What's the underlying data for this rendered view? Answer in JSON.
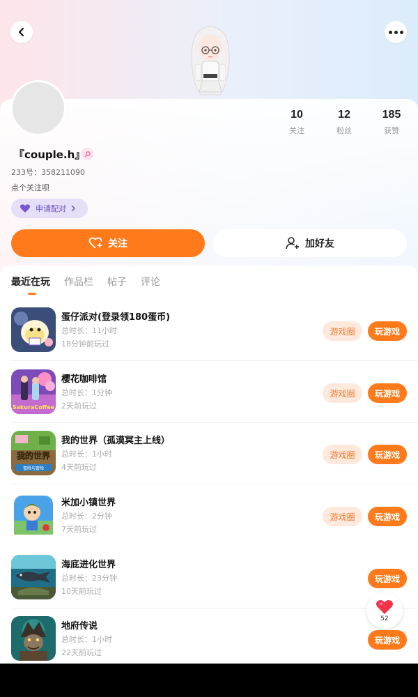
{
  "header": {
    "back_icon": "chevron-left-icon",
    "more_icon": "more-dots-icon"
  },
  "profile": {
    "nickname": "『couple.h』",
    "gender_icon": "female-icon",
    "uid": "233号：358211090",
    "bio": "点个关注呗",
    "pair_label": "申请配对",
    "stats": [
      {
        "value": "10",
        "label": "关注"
      },
      {
        "value": "12",
        "label": "粉丝"
      },
      {
        "value": "185",
        "label": "获赞"
      }
    ]
  },
  "actions": {
    "follow_label": "关注",
    "add_friend_label": "加好友"
  },
  "tabs": [
    {
      "label": "最近在玩",
      "active": true
    },
    {
      "label": "作品栏",
      "active": false
    },
    {
      "label": "帖子",
      "active": false
    },
    {
      "label": "评论",
      "active": false
    }
  ],
  "games": [
    {
      "title": "蛋仔派对(登录领180蛋币)",
      "duration": "总时长：11小时",
      "last": "18分钟前玩过",
      "circle": "游戏圈",
      "play": "玩游戏"
    },
    {
      "title": "樱花咖啡馆",
      "duration": "总时长：1分钟",
      "last": "2天前玩过",
      "circle": "游戏圈",
      "play": "玩游戏",
      "icon_text": "SakuraCoffee"
    },
    {
      "title": "我的世界（孤漠冥主上线）",
      "duration": "总时长：1小时",
      "last": "4天前玩过",
      "circle": "游戏圈",
      "play": "玩游戏",
      "icon_text": "我的世界",
      "icon_subtext": "冒险与冒险"
    },
    {
      "title": "米加小镇世界",
      "duration": "总时长：2分钟",
      "last": "7天前玩过",
      "circle": "游戏圈",
      "play": "玩游戏"
    },
    {
      "title": "海底进化世界",
      "duration": "总时长：23分钟",
      "last": "10天前玩过",
      "circle": "",
      "play": "玩游戏"
    },
    {
      "title": "地府传说",
      "duration": "总时长：1小时",
      "last": "22天前玩过",
      "circle": "",
      "play": "玩游戏"
    }
  ],
  "like_float": {
    "icon": "heart-icon",
    "count": "52"
  },
  "colors": {
    "accent": "#ff7a1a",
    "circle_bg": "#ffe9dc",
    "pair_bg": "#e5dff7"
  }
}
